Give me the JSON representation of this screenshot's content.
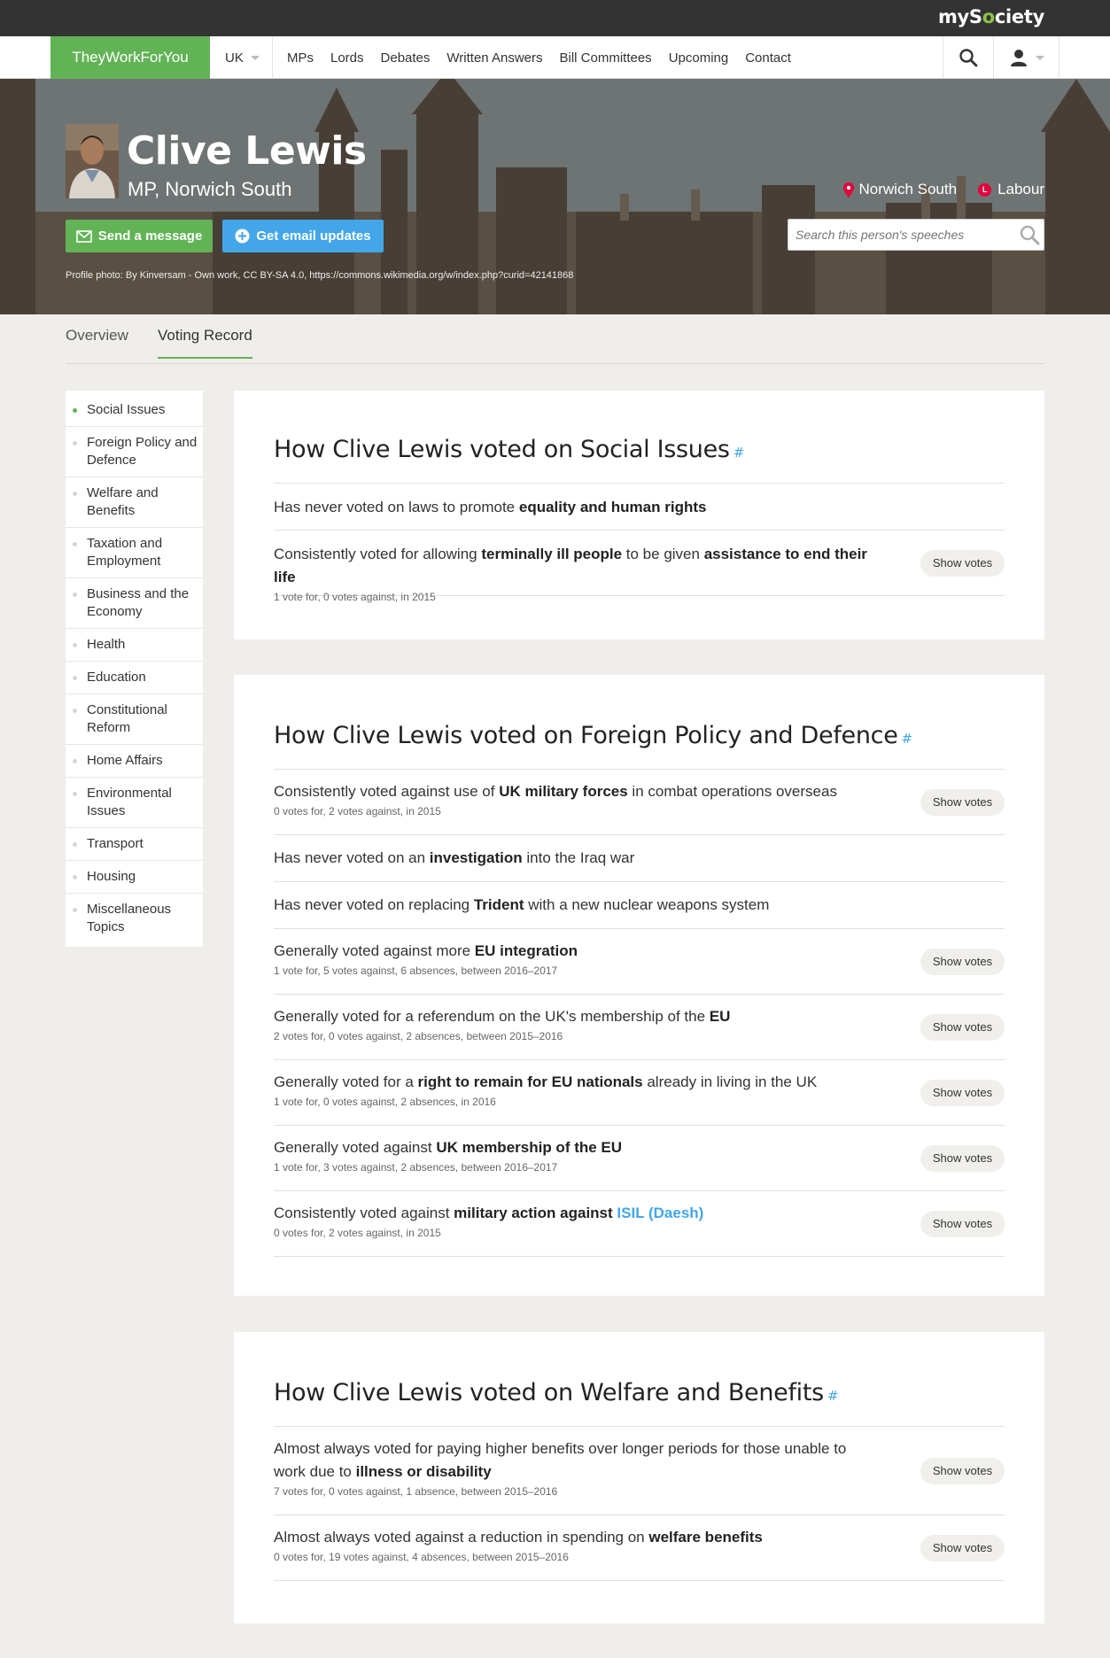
{
  "topbar": {
    "brand_pre": "myS",
    "brand_dot": "o",
    "brand_post": "ciety"
  },
  "nav": {
    "brand": "TheyWorkForYou",
    "country": "UK",
    "links": [
      "MPs",
      "Lords",
      "Debates",
      "Written Answers",
      "Bill Committees",
      "Upcoming",
      "Contact"
    ]
  },
  "hero": {
    "name": "Clive Lewis",
    "role": "MP, Norwich South",
    "constituency": "Norwich South",
    "party": "Labour",
    "party_badge": "L",
    "party_color": "#e4003b",
    "send_message": "Send a message",
    "email_updates": "Get email updates",
    "search_placeholder": "Search this person's speeches",
    "photo_credit": "Profile photo: By Kinversam - Own work, CC BY-SA 4.0, https://commons.wikimedia.org/w/index.php?curid=42141868"
  },
  "tabs": {
    "overview": "Overview",
    "voting": "Voting Record"
  },
  "sidebar": {
    "items": [
      "Social Issues",
      "Foreign Policy and Defence",
      "Welfare and Benefits",
      "Taxation and Employment",
      "Business and the Economy",
      "Health",
      "Education",
      "Constitutional Reform",
      "Home Affairs",
      "Environmental Issues",
      "Transport",
      "Housing",
      "Miscellaneous Topics"
    ],
    "active": "Social Issues"
  },
  "show_votes_label": "Show votes",
  "hash": "#",
  "sections": [
    {
      "title": "How Clive Lewis voted on Social Issues",
      "rows": [
        {
          "html": "Has never voted on laws to promote <b>equality and human rights</b>",
          "stats": "",
          "button": false
        },
        {
          "html": "Consistently voted for allowing <b>terminally ill people</b> to be given <b>assistance to end their life</b>",
          "stats": "1 vote for, 0 votes against, in 2015",
          "button": true
        }
      ]
    },
    {
      "title": "How Clive Lewis voted on Foreign Policy and Defence",
      "rows": [
        {
          "html": "Consistently voted against use of <b>UK military forces</b> in combat operations overseas",
          "stats": "0 votes for, 2 votes against, in 2015",
          "button": true
        },
        {
          "html": "Has never voted on an <b>investigation</b> into the Iraq war",
          "stats": "",
          "button": false
        },
        {
          "html": "Has never voted on replacing <b>Trident</b> with a new nuclear weapons system",
          "stats": "",
          "button": false
        },
        {
          "html": "Generally voted against more <b>EU integration</b>",
          "stats": "1 vote for, 5 votes against, 6 absences, between 2016–2017",
          "button": true
        },
        {
          "html": "Generally voted for a referendum on the UK's membership of the <b>EU</b>",
          "stats": "2 votes for, 0 votes against, 2 absences, between 2015–2016",
          "button": true
        },
        {
          "html": "Generally voted for a <b>right to remain for EU nationals</b> already in living in the UK",
          "stats": "1 vote for, 0 votes against, 2 absences, in 2016",
          "button": true
        },
        {
          "html": "Generally voted against <b>UK membership of the EU</b>",
          "stats": "1 vote for, 3 votes against, 2 absences, between 2016–2017",
          "button": true
        },
        {
          "html": "Consistently voted against <b>military action against <a>ISIL (Daesh)</a></b>",
          "stats": "0 votes for, 2 votes against, in 2015",
          "button": true
        }
      ]
    },
    {
      "title": "How Clive Lewis voted on Welfare and Benefits",
      "rows": [
        {
          "html": "Almost always voted for paying higher benefits over longer periods for those unable to work due to <b>illness or disability</b>",
          "stats": "7 votes for, 0 votes against, 1 absence, between 2015–2016",
          "button": true
        },
        {
          "html": "Almost always voted against a reduction in spending on <b>welfare benefits</b>",
          "stats": "0 votes for, 19 votes against, 4 absences, between 2015–2016",
          "button": true
        }
      ]
    }
  ]
}
